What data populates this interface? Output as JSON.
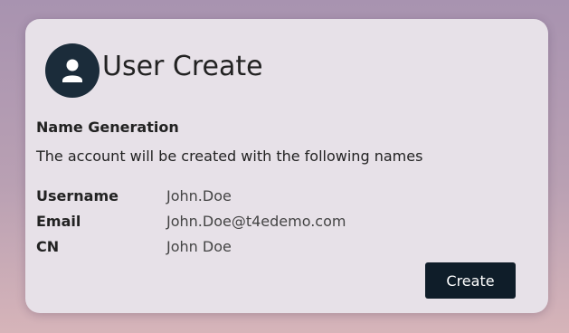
{
  "header": {
    "title": "User Create",
    "avatar_icon": "user-icon"
  },
  "section": {
    "title": "Name Generation",
    "description": "The account will be created with the following names"
  },
  "fields": [
    {
      "label": "Username",
      "value": "John.Doe"
    },
    {
      "label": "Email",
      "value": "John.Doe@t4edemo.com"
    },
    {
      "label": "CN",
      "value": "John Doe"
    }
  ],
  "actions": {
    "create_label": "Create"
  },
  "colors": {
    "button_bg": "#0f1d29",
    "avatar_bg": "#1b2c3a",
    "card_bg": "#e7e1e8"
  }
}
